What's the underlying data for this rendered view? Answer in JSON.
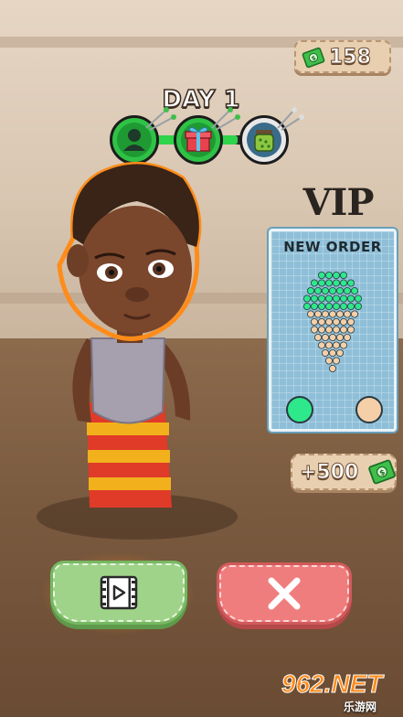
{
  "hud": {
    "money": "158",
    "money_icon": "cash-bill-icon",
    "day_label": "DAY 1",
    "stages": [
      {
        "icon": "customer-icon",
        "status": "done"
      },
      {
        "icon": "gift-box-icon",
        "status": "done"
      },
      {
        "icon": "bead-jar-icon",
        "status": "current"
      }
    ],
    "progress_fraction": 0.75
  },
  "order": {
    "tier_label": "VIP",
    "title": "NEW ORDER",
    "colors": [
      "#2ee88c",
      "#f4cfa8"
    ],
    "reward": "+500",
    "reward_icon": "cash-bill-icon"
  },
  "actions": {
    "watch_icon": "video-play-icon",
    "close_icon": "close-x-icon"
  },
  "watermark": {
    "main": "962.NET",
    "sub": "乐游网"
  },
  "colors": {
    "accent_green": "#2fd44a",
    "button_green": "#9fd38a",
    "button_red": "#f07d7d",
    "card_blue": "#8fbfd8"
  }
}
